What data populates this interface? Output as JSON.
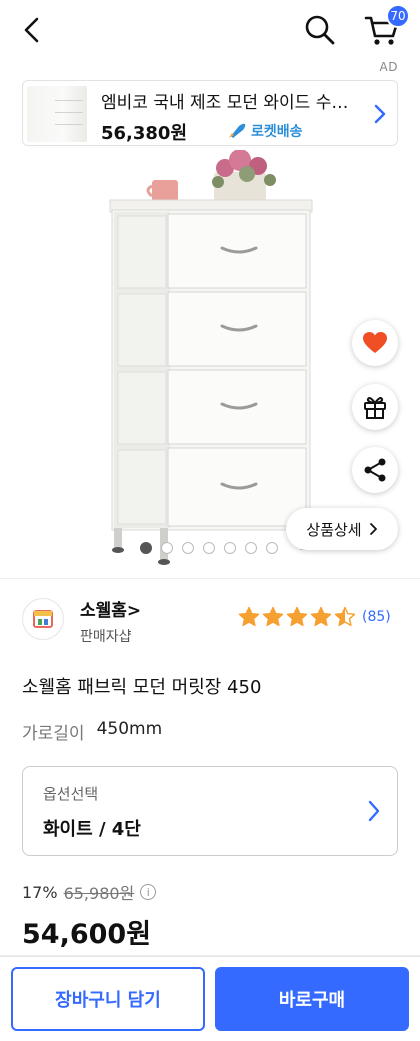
{
  "header": {
    "back_icon": "chevron-left-icon",
    "search_icon": "search-icon",
    "cart_icon": "cart-icon",
    "cart_count": "70"
  },
  "ad": {
    "label": "AD",
    "title": "엠비코 국내 제조 모던 와이드 수납장",
    "price": "56,380원",
    "rocket_label": "로켓배송"
  },
  "gallery": {
    "slide_count": 7,
    "active_index": 0,
    "detail_button": "상품상세"
  },
  "actions": {
    "wishlist_icon": "heart-icon",
    "gift_icon": "gift-icon",
    "share_icon": "share-icon"
  },
  "seller": {
    "name": "소웰홈>",
    "type": "판매자샵",
    "rating": 4.5,
    "review_count": "(85)"
  },
  "product": {
    "title": "소웰홈 패브릭 모던 머릿장 450",
    "spec_label": "가로길이",
    "spec_value": "450mm"
  },
  "option": {
    "label": "옵션선택",
    "value": "화이트 / 4단"
  },
  "price": {
    "discount": "17%",
    "original": "65,980원",
    "sale": "54,600원"
  },
  "bottom": {
    "cart_button": "장바구니 담기",
    "buy_button": "바로구매"
  },
  "colors": {
    "accent": "#346aff",
    "star": "#f5a030",
    "heart": "#f04e24",
    "rocket": "#2c8fd8"
  }
}
